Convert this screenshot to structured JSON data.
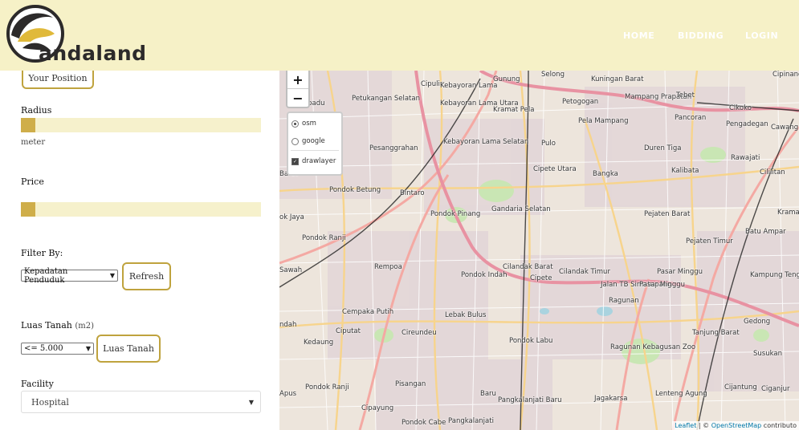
{
  "header": {
    "logo_text": "andaland",
    "nav": [
      {
        "label": "HOME"
      },
      {
        "label": "BIDDING"
      },
      {
        "label": "LOGIN"
      }
    ]
  },
  "sidebar": {
    "your_position_label": "Your Position",
    "radius": {
      "label": "Radius",
      "unit": "meter",
      "value_fraction": 0.0
    },
    "price": {
      "label": "Price",
      "value_fraction": 0.0
    },
    "filter": {
      "label": "Filter By:",
      "selected": "Kepadatan Penduduk",
      "refresh_label": "Refresh"
    },
    "luas_tanah": {
      "label": "Luas Tanah",
      "unit": "(m2)",
      "selected": "<= 5.000",
      "button_label": "Luas Tanah"
    },
    "facility": {
      "label": "Facility",
      "selected": "Hospital"
    }
  },
  "map": {
    "zoom_in": "+",
    "zoom_out": "−",
    "layers": [
      {
        "label": "osm",
        "type": "radio",
        "checked": true
      },
      {
        "label": "google",
        "type": "radio",
        "checked": false
      },
      {
        "label": "drawlayer",
        "type": "checkbox",
        "checked": true
      }
    ],
    "attribution": {
      "leaflet": "Leaflet",
      "sep": " | © ",
      "osm": "OpenStreetMap",
      "rest": " contributo"
    },
    "places": [
      "Cipulir",
      "Gunung",
      "Kuningan Barat",
      "Mampang Prapatan",
      "Cipinang",
      "Petukangan Selatan",
      "Kebayoran Lama Utara",
      "Kramat Pela",
      "Petogogan",
      "Tebet",
      "Cikoko",
      "Pela Mampang",
      "Pancoran",
      "Pengadegan",
      "Cawang",
      "Pesanggrahan",
      "Kebayoran Lama Selatan",
      "Pulo",
      "Duren Tiga",
      "Rawajati",
      "Cipete Utara",
      "Bangka",
      "Kalibata",
      "Cililitan",
      "Pondok Betung",
      "Bintaro",
      "Gandaria Selatan",
      "Pondok Pinang",
      "Pejaten Barat",
      "Kramat",
      "Pondok Ranji",
      "Batu Ampar",
      "Pejaten Timur",
      "Rempoa",
      "Cilandak Barat",
      "Cilandak Timur",
      "Pasar Minggu",
      "Kampung Teng",
      "Sawah",
      "Cempaka Putih",
      "Lebak Bulus",
      "Ragunan",
      "Gedong",
      "Ciputat",
      "Cireundeu",
      "Kedaung",
      "Pondok Labu",
      "Tanjung Barat",
      "Ragunan Kebagusan Zoo",
      "Susukan",
      "Pisangan",
      "Pondok Ranji",
      "Lenteng Agung",
      "Baru",
      "Ciganjur",
      "Cijantung",
      "Cipayung",
      "Pangkalanjati Baru",
      "Jagakarsa",
      "Pondok Cabe",
      "Pangkalanjati",
      "Kebayoran Lama",
      "Pondok Indah",
      "Cipete",
      "Jalan TB Simatupang",
      "Pasar Minggu",
      "Lipadu",
      "Barat",
      "ok Jaya",
      "ndah",
      "Apus",
      "Selong"
    ]
  }
}
